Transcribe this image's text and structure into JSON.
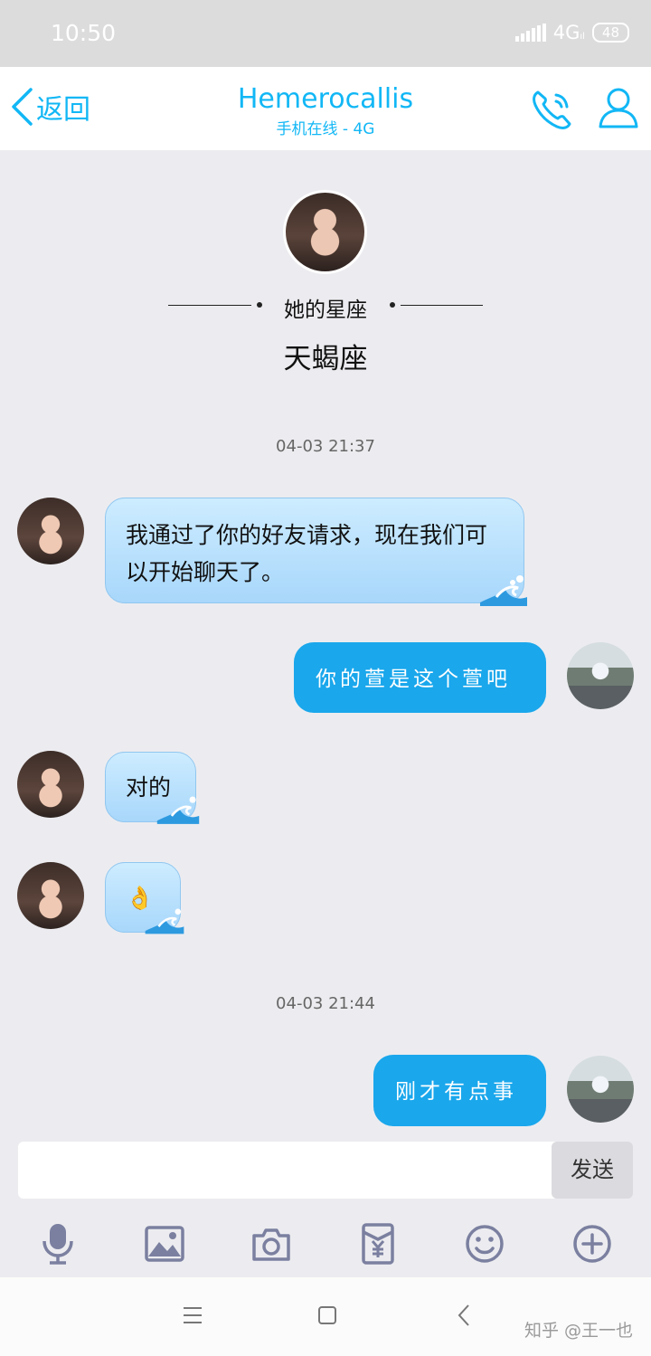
{
  "status_bar": {
    "time": "10:50",
    "network": "4G",
    "battery": "48",
    "network_suffix": "ıl"
  },
  "header": {
    "back_label": "返回",
    "title": "Hemerocallis",
    "subtitle": "手机在线 - 4G"
  },
  "profile": {
    "zodiac_label": "她的星座",
    "zodiac_value": "天蝎座"
  },
  "messages": [
    {
      "timestamp": "04-03 21:37"
    },
    {
      "from": "her",
      "text": "我通过了你的好友请求，现在我们可以开始聊天了。"
    },
    {
      "from": "me",
      "text": "你的萱是这个萱吧"
    },
    {
      "from": "her",
      "text": "对的"
    },
    {
      "from": "her",
      "text": "👌"
    },
    {
      "timestamp": "04-03 21:44"
    },
    {
      "from": "me",
      "text": "刚才有点事"
    }
  ],
  "composer": {
    "input_value": "",
    "send_label": "发送"
  },
  "toolbar_icons": [
    "microphone-icon",
    "image-icon",
    "camera-icon",
    "red-packet-icon",
    "emoji-icon",
    "plus-icon"
  ],
  "nav_icons": [
    "menu-icon",
    "home-icon",
    "back-icon"
  ],
  "watermark": "知乎 @王一也",
  "colors": {
    "accent": "#12b7f5",
    "outgoing_bubble": "#1aa7ec",
    "incoming_bubble": "#bfe4ff",
    "background": "#ececf0"
  }
}
